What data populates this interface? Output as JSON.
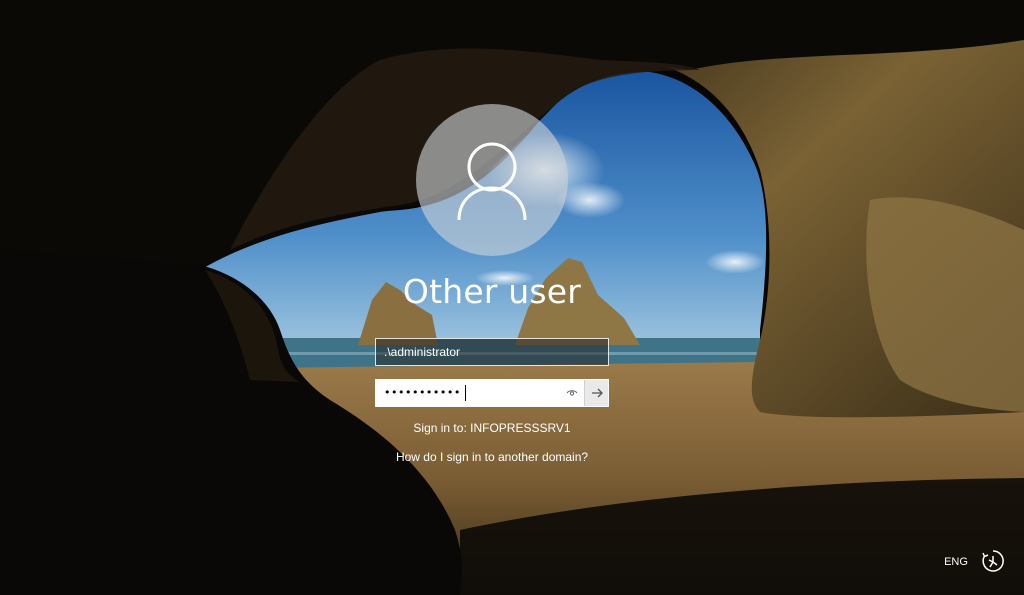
{
  "colors": {
    "sky_top": "#1f5fa8",
    "sky_bottom": "#7fb3da",
    "sea": "#3d7186",
    "sand": "#8a6a3e",
    "rock": "#6b5635",
    "cave_dark": "#060606",
    "text": "#ffffff",
    "avatar_circle": "#cdd2d6"
  },
  "icons": {
    "user_avatar": "user-silhouette-icon",
    "reveal_password": "eye-icon",
    "submit": "arrow-right-icon",
    "ease_of_access": "ease-of-access-icon"
  },
  "login": {
    "user_name": "Other user",
    "username_value": ".\\administrator",
    "password_masked": "•••••••••••",
    "sign_in_to": "Sign in to: INFOPRESSSRV1",
    "other_domain_link": "How do I sign in to another domain?"
  },
  "footer": {
    "language": "ENG"
  }
}
